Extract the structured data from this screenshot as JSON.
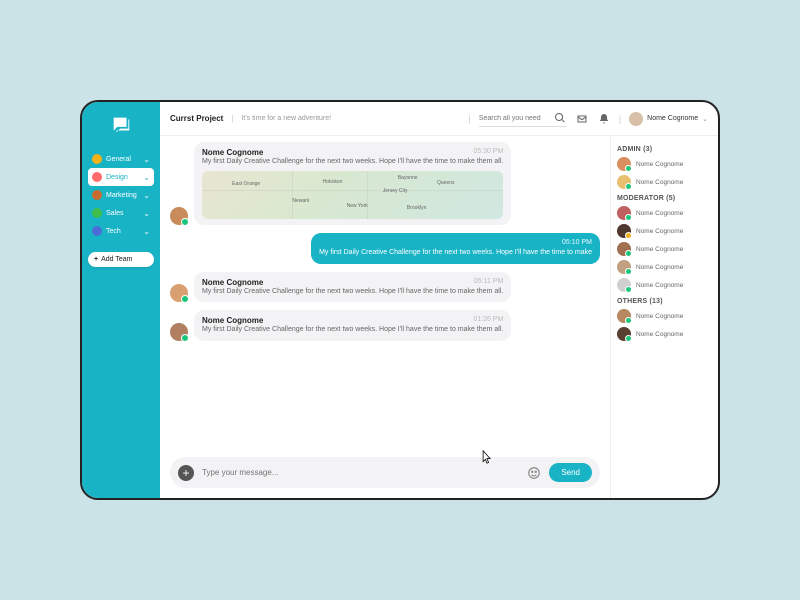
{
  "header": {
    "project_label": "Currst Project",
    "subtitle": "It's time for a new adventure!",
    "search_placeholder": "Search all you need",
    "user_name": "Nome Cognome"
  },
  "sidebar": {
    "items": [
      {
        "label": "General",
        "color": "#f2b21a",
        "active": false
      },
      {
        "label": "Design",
        "color": "#ff6b6b",
        "active": true
      },
      {
        "label": "Marketing",
        "color": "#c96b2e",
        "active": false
      },
      {
        "label": "Sales",
        "color": "#3fbf4a",
        "active": false
      },
      {
        "label": "Tech",
        "color": "#4a6bd8",
        "active": false
      }
    ],
    "add_team": "Add Team"
  },
  "messages": [
    {
      "mine": false,
      "name": "Nome Cognome",
      "time": "05:30 PM",
      "text": "My first Daily Creative Challenge for the next two weeks. Hope I'll have the time to make them all.",
      "map": true,
      "avatar": "#c98b5a"
    },
    {
      "mine": true,
      "time": "05:10 PM",
      "text": "My first Daily Creative Challenge for the next two weeks. Hope I'll have the time to make"
    },
    {
      "mine": false,
      "name": "Nome Cognome",
      "time": "05:11 PM",
      "text": "My first Daily Creative Challenge for the next two weeks. Hope I'll have the time to make them all.",
      "avatar": "#d8a070"
    },
    {
      "mine": false,
      "name": "Nome Cognome",
      "time": "01:26 PM",
      "text": "My first Daily Creative Challenge for the next two weeks. Hope I'll have the time to make them all.",
      "avatar": "#b08060"
    }
  ],
  "map_labels": [
    "East Orange",
    "Newark",
    "Hoboken",
    "New York",
    "Jersey City",
    "Brooklyn",
    "Queens",
    "Bayonne"
  ],
  "composer": {
    "placeholder": "Type your message...",
    "send": "Send"
  },
  "people": {
    "sections": [
      {
        "title": "ADMIN (3)",
        "members": [
          {
            "name": "Nome Cognome",
            "color": "#d89060",
            "status": "online"
          },
          {
            "name": "Nome Cognome",
            "color": "#e8c070",
            "status": "online"
          }
        ]
      },
      {
        "title": "MODERATOR (5)",
        "members": [
          {
            "name": "Nome Cognome",
            "color": "#c06060",
            "status": "online"
          },
          {
            "name": "Nome Cognome",
            "color": "#503830",
            "status": "away"
          },
          {
            "name": "Nome Cognome",
            "color": "#a07050",
            "status": "online"
          },
          {
            "name": "Nome Cognome",
            "color": "#c0a080",
            "status": "online"
          },
          {
            "name": "Nome Cognome",
            "color": "#d0d0d0",
            "status": "online"
          }
        ]
      },
      {
        "title": "OTHERS (13)",
        "members": [
          {
            "name": "Nome Cognome",
            "color": "#b88860",
            "status": "online"
          },
          {
            "name": "Nome Cognome",
            "color": "#5a4030",
            "status": "online"
          }
        ]
      }
    ]
  }
}
